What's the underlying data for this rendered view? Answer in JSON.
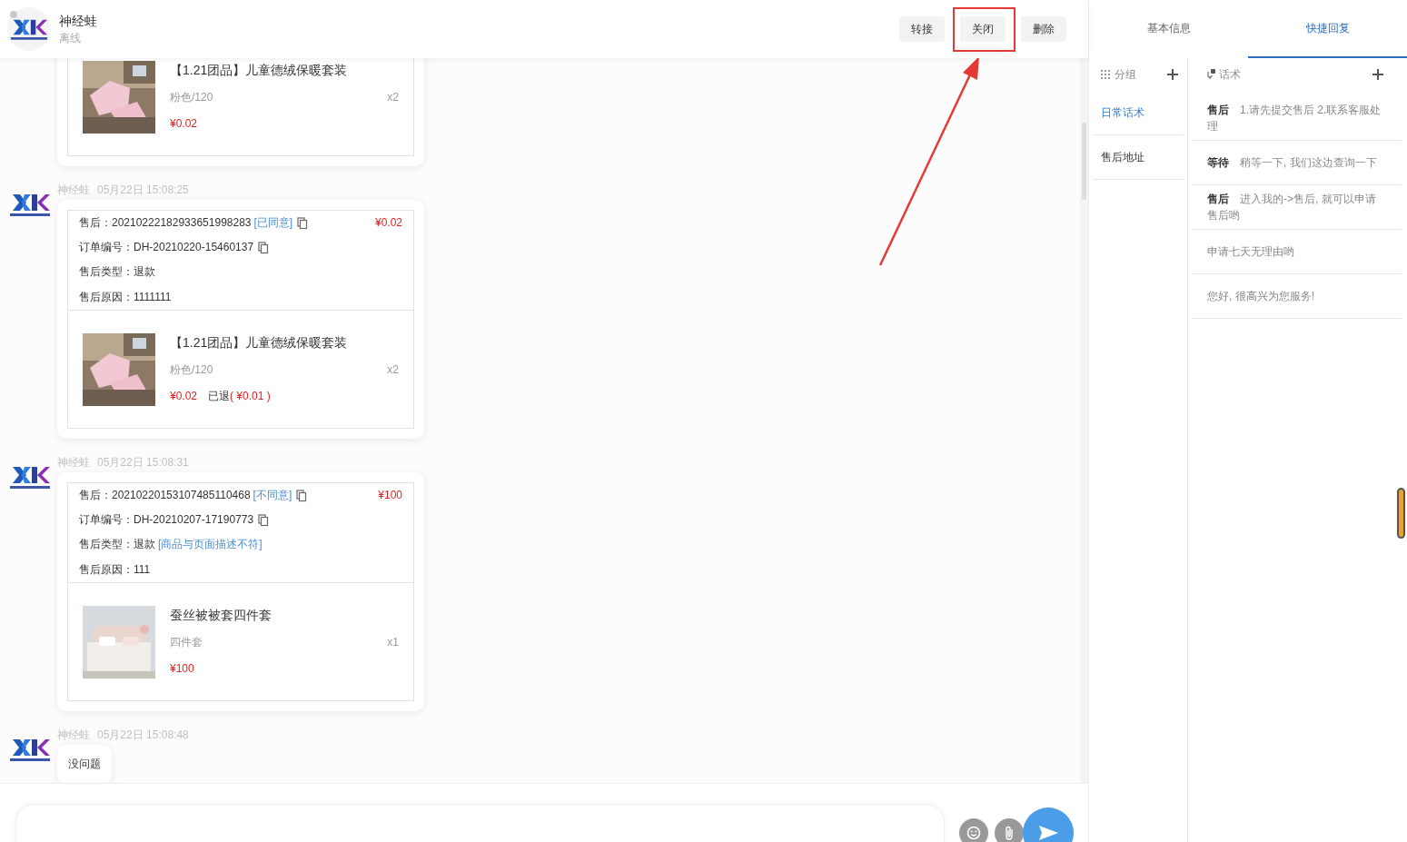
{
  "header": {
    "name": "神经蛙",
    "status": "离线",
    "online": false,
    "buttons": [
      "转接",
      "关闭",
      "删除"
    ]
  },
  "messages": [
    {
      "kind": "product_only",
      "product": {
        "kind": "clothing",
        "title": "【1.21团品】儿童德绒保暖套装",
        "spec": "粉色/120",
        "qty": "x2",
        "price": "¥0.02"
      }
    },
    {
      "kind": "after_sale",
      "sender": "神经蛙",
      "time": "05月22日 15:08:25",
      "refund_label": "售后：",
      "refund_no": "20210222182933651998283",
      "status_tag": "[已同意]",
      "amount": "¥0.02",
      "order_label": "订单编号：",
      "order_no": "DH-20210220-15460137",
      "type_label": "售后类型：",
      "type": "退款",
      "reason_label": "售后原因：",
      "reason": "1111111",
      "product": {
        "kind": "clothing",
        "title": "【1.21团品】儿童德绒保暖套装",
        "spec": "粉色/120",
        "qty": "x2",
        "price": "¥0.02",
        "refunded": "已退",
        "refunded_amount": "( ¥0.01 )"
      }
    },
    {
      "kind": "after_sale",
      "sender": "神经蛙",
      "time": "05月22日 15:08:31",
      "refund_label": "售后：",
      "refund_no": "20210220153107485110468",
      "status_tag": "[不同意]",
      "amount": "¥100",
      "order_label": "订单编号：",
      "order_no": "DH-20210207-17190773",
      "type_label": "售后类型：",
      "type": "退款",
      "type_tag": "[商品与页面描述不符]",
      "reason_label": "售后原因：",
      "reason": "111",
      "product": {
        "kind": "bedding",
        "title": "蚕丝被被套四件套",
        "spec": "四件套",
        "qty": "x1",
        "price": "¥100"
      }
    },
    {
      "kind": "text",
      "sender": "神经蛙",
      "time": "05月22日 15:08:48",
      "text": "没问题"
    }
  ],
  "side": {
    "tabs": [
      {
        "label": "基本信息",
        "selected": false
      },
      {
        "label": "快捷回复",
        "selected": true
      }
    ],
    "group_header": "分组",
    "groups": [
      {
        "label": "日常话术",
        "selected": true
      },
      {
        "label": "售后地址",
        "selected": false
      }
    ],
    "script_header": "话术",
    "scripts": [
      {
        "tag": "售后",
        "text": "1.请先提交售后 2.联系客服处理"
      },
      {
        "tag": "等待",
        "text": "稍等一下, 我们这边查询一下"
      },
      {
        "tag": "售后",
        "text": "进入我的->售后, 就可以申请售后哟"
      },
      {
        "text": "申请七天无理由哟"
      },
      {
        "text": "您好, 很高兴为您服务!"
      }
    ]
  }
}
